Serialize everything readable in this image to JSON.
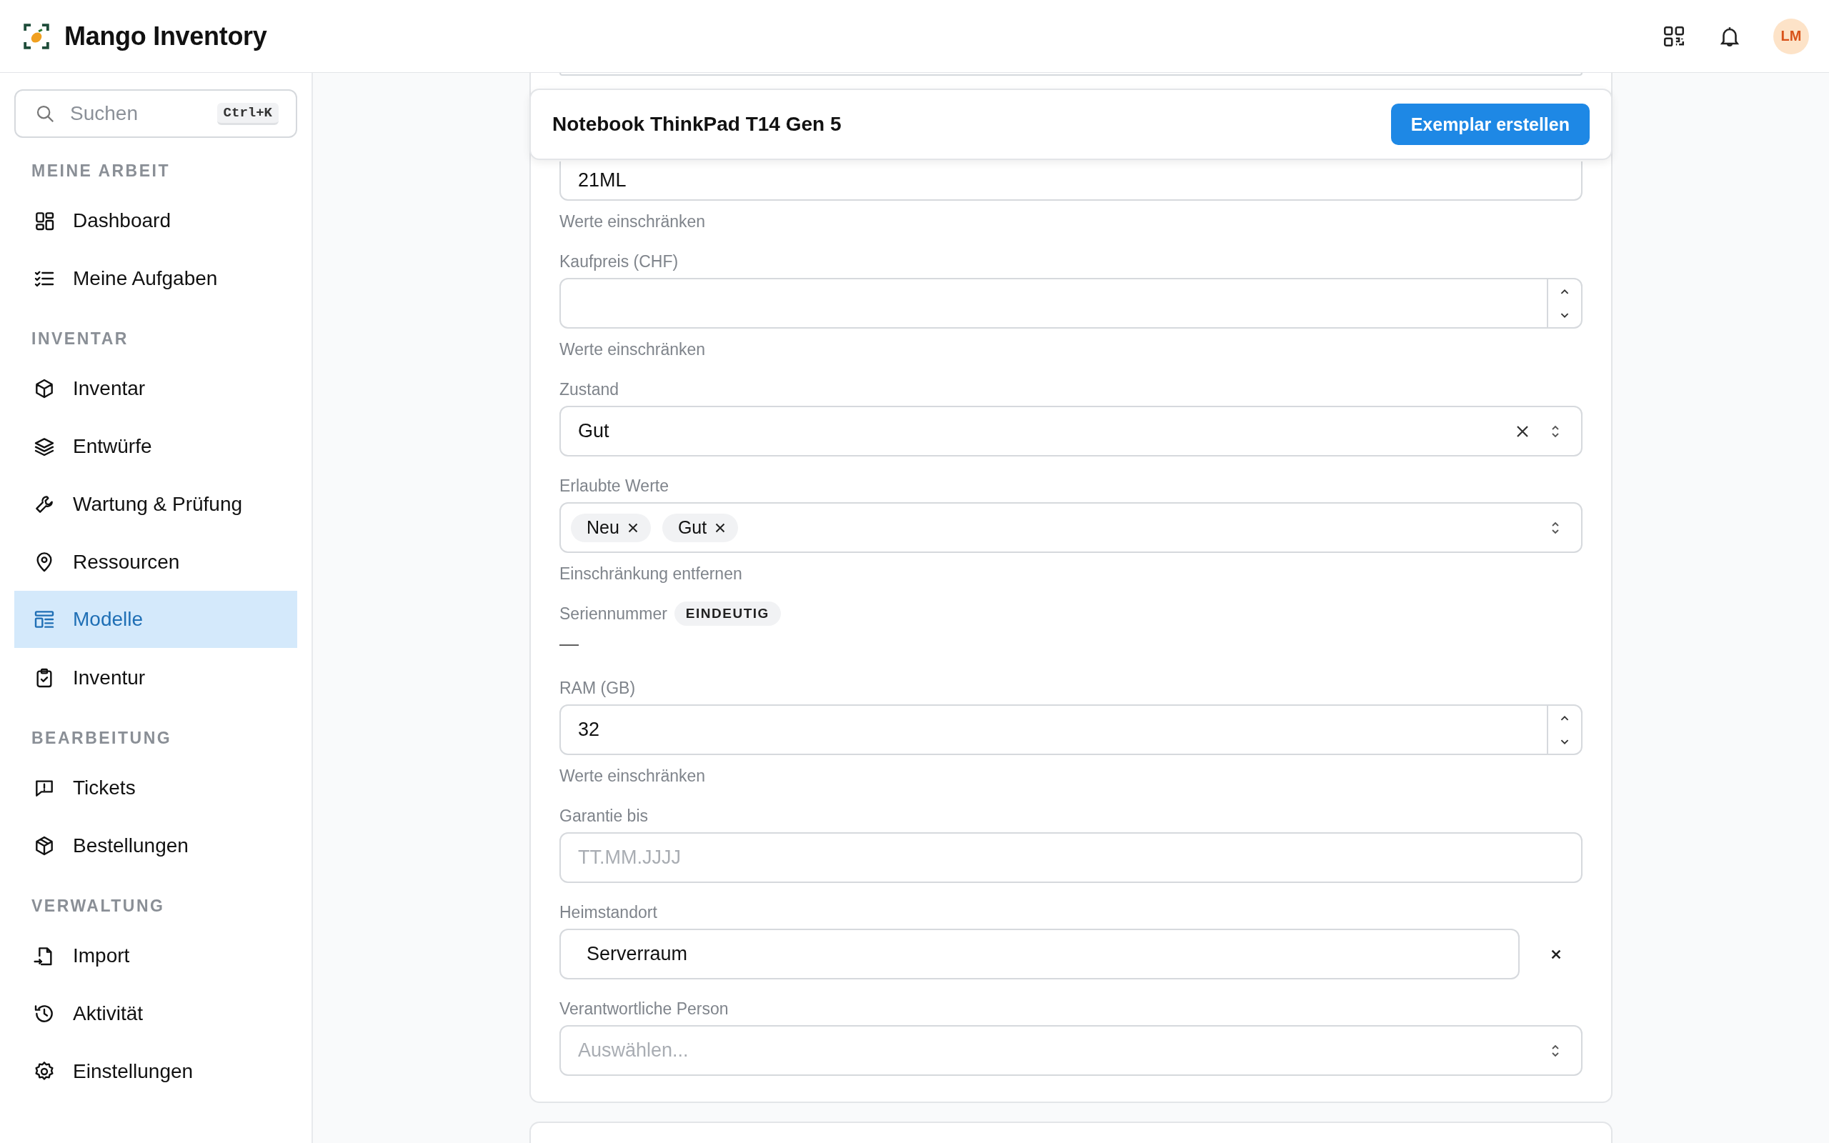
{
  "app": {
    "title": "Mango Inventory",
    "avatar": "LM"
  },
  "sidebar": {
    "search": {
      "placeholder": "Suchen",
      "shortcut": "Ctrl+K"
    },
    "sections": [
      {
        "heading": "MEINE ARBEIT",
        "items": [
          {
            "label": "Dashboard",
            "selected": false
          },
          {
            "label": "Meine Aufgaben",
            "selected": false
          }
        ]
      },
      {
        "heading": "INVENTAR",
        "items": [
          {
            "label": "Inventar",
            "selected": false
          },
          {
            "label": "Entwürfe",
            "selected": false
          },
          {
            "label": "Wartung & Prüfung",
            "selected": false
          },
          {
            "label": "Ressourcen",
            "selected": false
          },
          {
            "label": "Modelle",
            "selected": true
          },
          {
            "label": "Inventur",
            "selected": false
          }
        ]
      },
      {
        "heading": "BEARBEITUNG",
        "items": [
          {
            "label": "Tickets",
            "selected": false
          },
          {
            "label": "Bestellungen",
            "selected": false
          }
        ]
      },
      {
        "heading": "VERWALTUNG",
        "items": [
          {
            "label": "Import",
            "selected": false
          },
          {
            "label": "Aktivität",
            "selected": false
          },
          {
            "label": "Einstellungen",
            "selected": false
          }
        ]
      }
    ]
  },
  "detail": {
    "title": "Notebook ThinkPad T14 Gen 5",
    "action": "Exemplar erstellen",
    "fields": [
      {
        "kind": "text",
        "value": "21ML",
        "helper": "Werte einschränken"
      },
      {
        "kind": "number",
        "label": "Kaufpreis (CHF)",
        "helper": "Werte einschränken"
      },
      {
        "kind": "select",
        "label": "Zustand",
        "value": "Gut",
        "clearable": true
      },
      {
        "kind": "multi",
        "label": "Erlaubte Werte",
        "tags": [
          "Neu",
          "Gut"
        ],
        "helper": "Einschränkung entfernen"
      },
      {
        "kind": "readonly",
        "label": "Seriennummer",
        "badge": "EINDEUTIG",
        "value": "—"
      },
      {
        "kind": "number",
        "label": "RAM (GB)",
        "value": "32",
        "helper": "Werte einschränken"
      },
      {
        "kind": "text",
        "label": "Garantie bis",
        "placeholder": "TT.MM.JJJJ"
      },
      {
        "kind": "location",
        "label": "Heimstandort",
        "value": "Serverraum"
      },
      {
        "kind": "select",
        "label": "Verantwortliche Person",
        "placeholder": "Auswählen...",
        "clearable": false
      }
    ]
  }
}
